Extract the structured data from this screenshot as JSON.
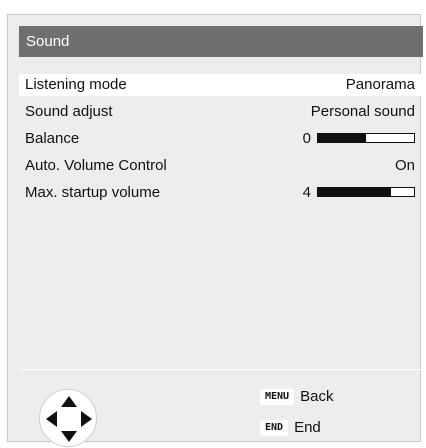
{
  "panel": {
    "title": "Sound"
  },
  "menu": {
    "items": [
      {
        "label": "Listening mode",
        "value": "Panorama",
        "selected": true
      },
      {
        "label": "Sound adjust",
        "value": "Personal sound"
      },
      {
        "label": "Balance",
        "value": "0",
        "level": 0.5
      },
      {
        "label": "Auto. Volume Control",
        "value": "On"
      },
      {
        "label": "Max. startup volume",
        "value": "4",
        "level": 0.76
      }
    ]
  },
  "footer": {
    "nav_icon": "dpad-arrows-icon",
    "keys": [
      {
        "badge": "MENU",
        "label": "Back"
      },
      {
        "badge": "END",
        "label": "End"
      }
    ]
  }
}
